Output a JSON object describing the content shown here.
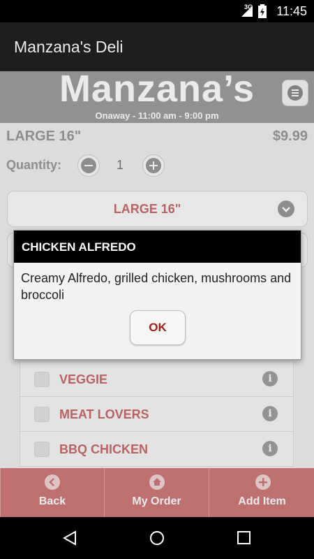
{
  "status_bar": {
    "network": "3G",
    "time": "11:45"
  },
  "app_bar": {
    "title": "Manzana's Deli"
  },
  "banner": {
    "logo": "Manzana’s",
    "hours": "Onaway - 11:00 am - 9:00 pm"
  },
  "item": {
    "size_title": "LARGE 16\"",
    "price": "$9.99"
  },
  "quantity": {
    "label": "Quantity:",
    "value": "1"
  },
  "size_select": {
    "selected": "LARGE 16\""
  },
  "toppings": [
    {
      "name": "VEGGIE"
    },
    {
      "name": "MEAT LOVERS"
    },
    {
      "name": "BBQ CHICKEN"
    }
  ],
  "bottom_bar": {
    "back": "Back",
    "my_order": "My Order",
    "add_item": "Add Item"
  },
  "dialog": {
    "title": "CHICKEN ALFREDO",
    "description": "Creamy Alfredo, grilled chicken, mushrooms and broccoli",
    "ok_label": "OK"
  },
  "colors": {
    "accent": "#cf7a7a",
    "item_text": "#c96b6b",
    "ok_text": "#a11d1d"
  },
  "icons": {
    "menu": "menu-icon",
    "minus": "minus-icon",
    "plus": "plus-icon",
    "chevron": "chevron-down-icon",
    "info": "info-icon",
    "back": "back-icon",
    "home": "home-icon",
    "add": "add-icon"
  }
}
